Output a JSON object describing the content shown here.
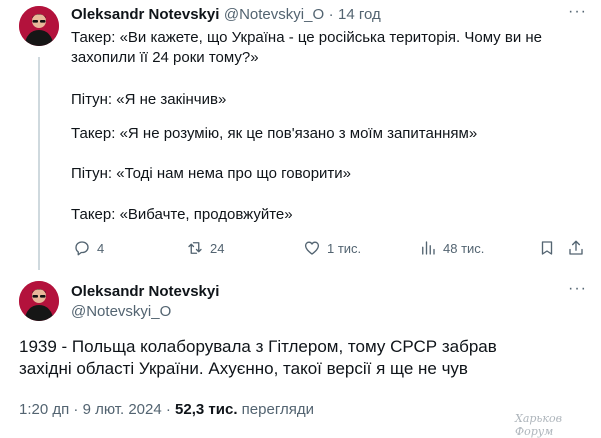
{
  "tweet1": {
    "author_name": "Oleksandr Notevskyi",
    "author_handle": "@Notevskyi_O",
    "separator": "·",
    "time": "14 год",
    "paragraphs": [
      "Такер: «Ви кажете, що Україна - це російська територія. Чому ви не захопили її 24 роки тому?»",
      "Пітун: «Я не закінчив»",
      "Такер: «Я не розумію, як це пов'язано з моїм запитанням»",
      "Пітун: «Тоді нам нема про що говорити»",
      "Такер: «Вибачте, продовжуйте»"
    ],
    "actions": {
      "replies": "4",
      "reposts": "24",
      "likes": "1 тис.",
      "views": "48 тис."
    }
  },
  "tweet2": {
    "author_name": "Oleksandr Notevskyi",
    "author_handle": "@Notevskyi_O",
    "text": "1939 - Польща колаборувала з Гітлером, тому СРСР забрав західні області України. Ахуєнно, такої версії я ще не чув",
    "time": "1:20 дп",
    "date": "9 лют. 2024",
    "separator": "·",
    "views_count": "52,3 тис.",
    "views_label": "перегляди"
  },
  "icons": {
    "more": "more-horizontal-icon",
    "reply": "reply-icon",
    "repost": "repost-icon",
    "like": "heart-icon",
    "views": "views-icon",
    "bookmark": "bookmark-icon",
    "share": "share-icon"
  },
  "watermark": "Харьков Форум"
}
